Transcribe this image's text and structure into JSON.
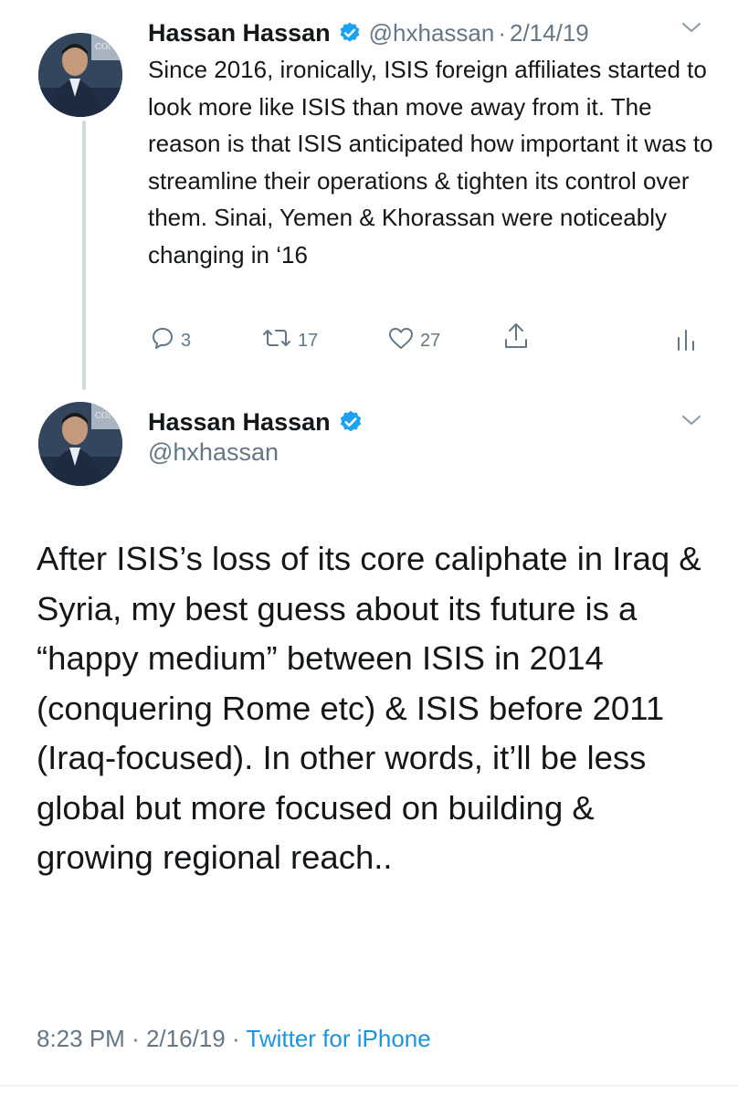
{
  "tweets": [
    {
      "author_name": "Hassan Hassan",
      "handle": "@hxhassan",
      "separator": "·",
      "date": "2/14/19",
      "text": "Since 2016, ironically, ISIS foreign affiliates started to look more like ISIS than move away from it. The reason is that ISIS anticipated how important it was to streamline their operations & tighten its control over them. Sinai, Yemen & Khorassan were noticeably changing in ‘16",
      "replies": "3",
      "retweets": "17",
      "likes": "27"
    },
    {
      "author_name": "Hassan Hassan",
      "handle": "@hxhassan",
      "text": "After ISIS’s loss of its core caliphate in Iraq & Syria, my best guess about its future is a “happy medium” between ISIS in 2014 (conquering Rome etc) & ISIS before 2011 (Iraq-focused). In other words, it’ll be less global but more focused on building & growing regional reach..",
      "time": "8:23 PM",
      "separator": "·",
      "date": "2/16/19",
      "separator2": "·",
      "source": "Twitter for iPhone"
    }
  ],
  "colors": {
    "text_primary": "#14171a",
    "text_secondary": "#657786",
    "link": "#1b95e0",
    "verified": "#1da1f2",
    "thread_line": "#cfd9de"
  },
  "icons": {
    "verified": "verified-badge-icon",
    "menu": "chevron-down-icon",
    "reply": "reply-icon",
    "retweet": "retweet-icon",
    "like": "heart-icon",
    "share": "share-icon",
    "analytics": "analytics-icon"
  }
}
